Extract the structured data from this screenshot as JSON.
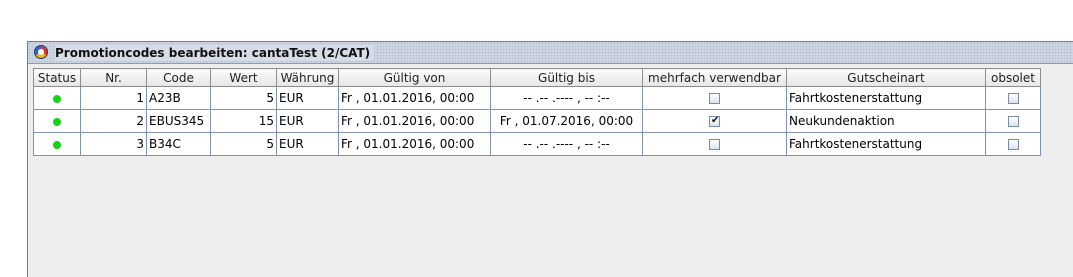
{
  "window": {
    "title": "Promotioncodes bearbeiten: cantaTest (2/CAT)",
    "icon": "app-logo-icon"
  },
  "table": {
    "columns": [
      "Status",
      "Nr.",
      "Code",
      "Wert",
      "Währung",
      "Gültig von",
      "Gültig bis",
      "mehrfach verwendbar",
      "Gutscheinart",
      "obsolet"
    ],
    "rows": [
      {
        "status_color": "#12d412",
        "nr": "1",
        "code": "A23B",
        "wert": "5",
        "waehrung": "EUR",
        "gueltig_von": "Fr , 01.01.2016, 00:00",
        "gueltig_bis": "-- .-- .----   , -- :--",
        "mehrfach": false,
        "gutscheinart": "Fahrtkostenerstattung",
        "obsolet": false
      },
      {
        "status_color": "#12d412",
        "nr": "2",
        "code": "EBUS345",
        "wert": "15",
        "waehrung": "EUR",
        "gueltig_von": "Fr , 01.01.2016, 00:00",
        "gueltig_bis": "Fr , 01.07.2016, 00:00",
        "mehrfach": true,
        "gutscheinart": "Neukundenaktion",
        "obsolet": false
      },
      {
        "status_color": "#12d412",
        "nr": "3",
        "code": "B34C",
        "wert": "5",
        "waehrung": "EUR",
        "gueltig_von": "Fr , 01.01.2016, 00:00",
        "gueltig_bis": "-- .-- .----   , -- :--",
        "mehrfach": false,
        "gutscheinart": "Fahrtkostenerstattung",
        "obsolet": false
      }
    ]
  }
}
